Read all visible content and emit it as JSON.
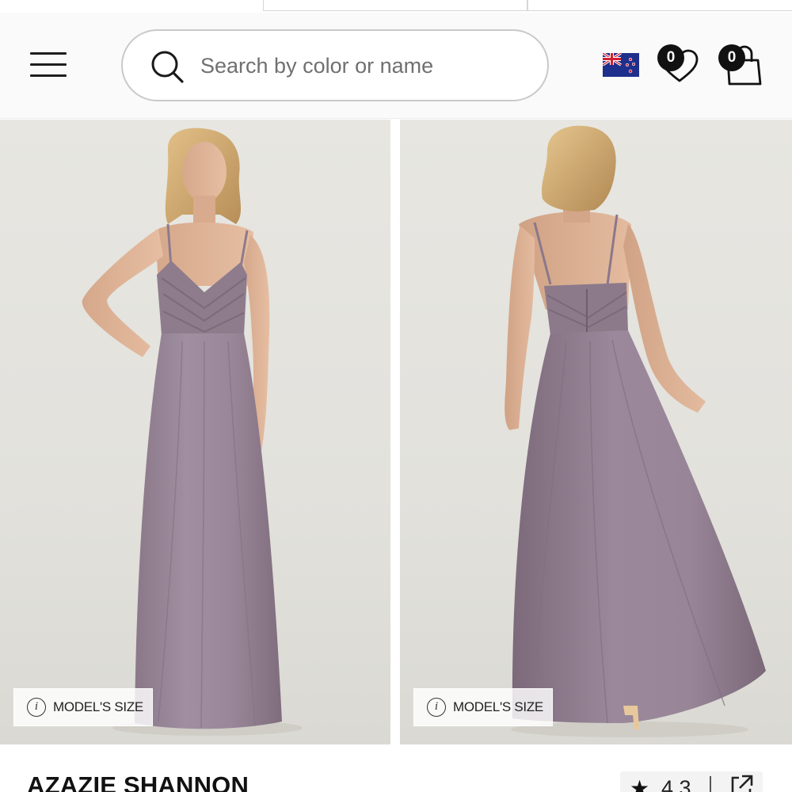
{
  "header": {
    "search_placeholder": "Search by color or name",
    "wishlist_count": "0",
    "cart_count": "0",
    "region_flag": "new-zealand-flag-icon"
  },
  "gallery": {
    "images": [
      {
        "view": "front",
        "models_size_label": "MODEL'S SIZE"
      },
      {
        "view": "back",
        "models_size_label": "MODEL'S SIZE"
      }
    ],
    "dress_color": "#958394"
  },
  "product": {
    "title": "AZAZIE SHANNON",
    "rating": "4.3"
  },
  "colors": {
    "accent": "#111111",
    "background": "#fafafa",
    "photo_background": "#e5e4df"
  }
}
